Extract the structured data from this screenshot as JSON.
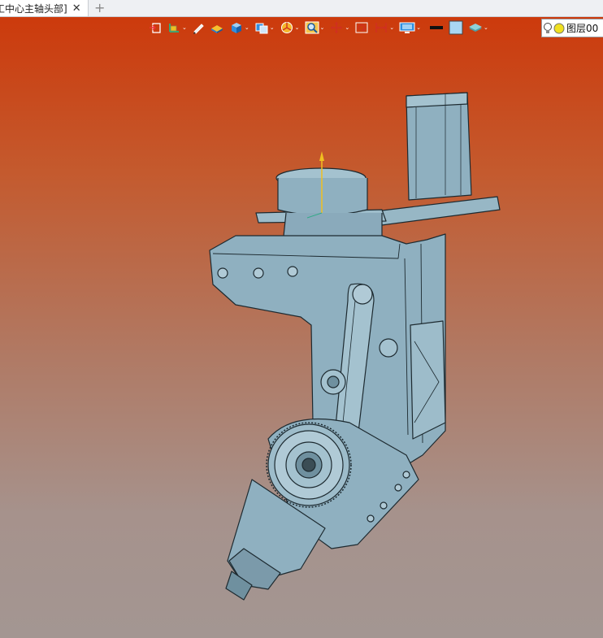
{
  "tab": {
    "title": "工中心主轴头部]",
    "close_glyph": "✕",
    "add_glyph": "+"
  },
  "toolbar": {
    "items": [
      {
        "name": "view-cube-icon",
        "dropdown": false
      },
      {
        "name": "coordinate-icon",
        "dropdown": true
      },
      {
        "name": "pen-icon",
        "dropdown": false
      },
      {
        "name": "render-mode-icon",
        "dropdown": false
      },
      {
        "name": "shaded-solid-icon",
        "dropdown": true
      },
      {
        "name": "section-view-icon",
        "dropdown": true
      },
      {
        "name": "appearance-icon",
        "dropdown": true
      },
      {
        "name": "zoom-icon",
        "dropdown": true
      },
      {
        "name": "pan-icon",
        "dropdown": true
      },
      {
        "name": "rotate-icon",
        "dropdown": false
      },
      {
        "name": "dimension-icon",
        "dropdown": true
      },
      {
        "name": "display-icon",
        "dropdown": true
      },
      {
        "name": "line-color-swatch",
        "dropdown": false
      },
      {
        "name": "fill-color-swatch",
        "dropdown": false
      },
      {
        "name": "layer-stack-icon",
        "dropdown": true
      }
    ],
    "caret_glyph": "⌄"
  },
  "layer": {
    "label": "图层00"
  },
  "colors": {
    "gradient_top": "#cc3a0c",
    "gradient_bottom": "#a39692",
    "part": "#8fb0c0",
    "edge": "#1d2a30"
  }
}
